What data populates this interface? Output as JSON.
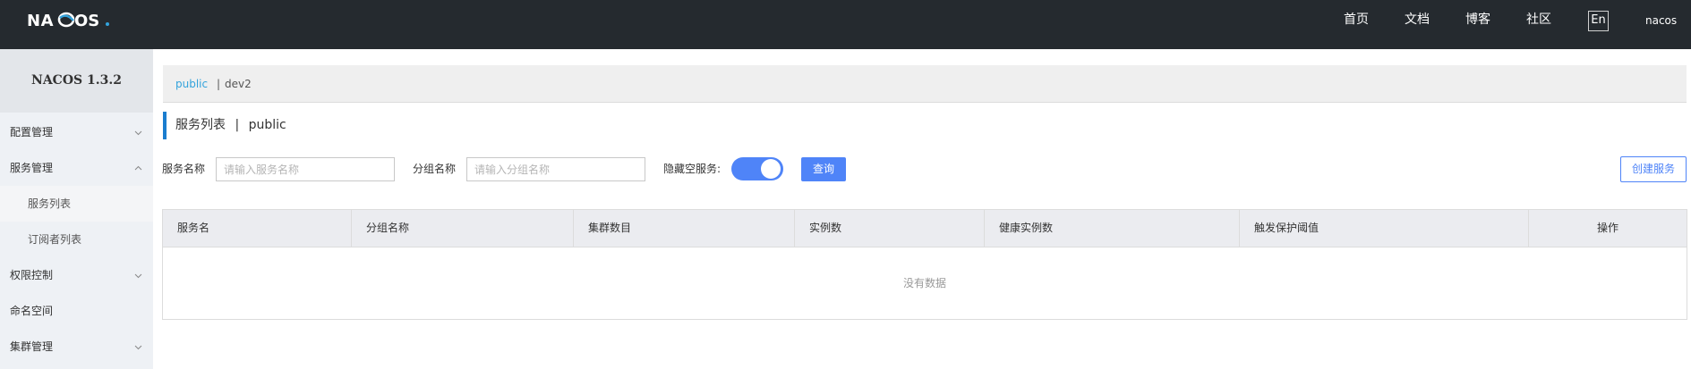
{
  "header": {
    "logo_text": "NACOS.",
    "nav": [
      "首页",
      "文档",
      "博客",
      "社区"
    ],
    "lang_button": "En",
    "user": "nacos"
  },
  "sidebar": {
    "version": "NACOS 1.3.2",
    "items": [
      {
        "label": "配置管理",
        "icon": "chevron-down-icon"
      },
      {
        "label": "服务管理",
        "icon": "chevron-up-icon"
      },
      {
        "label": "服务列表",
        "sub": true,
        "active": true
      },
      {
        "label": "订阅者列表",
        "sub": true
      },
      {
        "label": "权限控制",
        "icon": "chevron-down-icon"
      },
      {
        "label": "命名空间"
      },
      {
        "label": "集群管理",
        "icon": "chevron-down-icon"
      }
    ]
  },
  "namespace": {
    "current": "public",
    "separator": "|",
    "other": "dev2"
  },
  "page": {
    "title": "服务列表",
    "title_sep": "|",
    "title_ns": "public"
  },
  "filters": {
    "service_name_label": "服务名称",
    "service_name_placeholder": "请输入服务名称",
    "group_name_label": "分组名称",
    "group_name_placeholder": "请输入分组名称",
    "hide_empty_label": "隐藏空服务:",
    "hide_empty_on": true,
    "query_button": "查询",
    "create_button": "创建服务"
  },
  "table": {
    "columns": [
      "服务名",
      "分组名称",
      "集群数目",
      "实例数",
      "健康实例数",
      "触发保护阈值",
      "操作"
    ],
    "rows": [],
    "empty_text": "没有数据"
  },
  "colors": {
    "topbar": "#252a2f",
    "accent": "#4f84f8",
    "link": "#33a3dc",
    "title_bar": "#1a7dcf"
  }
}
